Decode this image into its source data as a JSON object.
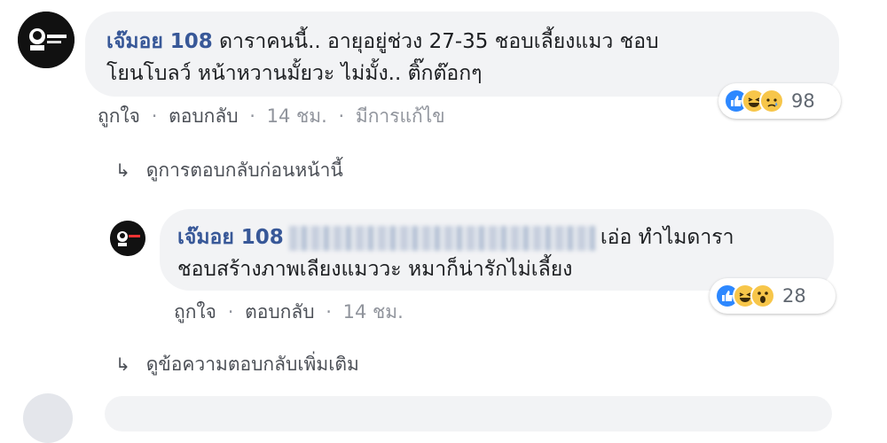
{
  "comment": {
    "author": "เจ๊มอย 108",
    "text_line1": " ดาราคนนี้.. อายุอยู่ช่วง 27-35 ชอบเลี้ยงแมว ชอบ",
    "text_line2": "โยนโบลว์ หน้าหวานมั้ยวะ ไม่มั้ง.. ติ๊กต๊อกๆ",
    "actions": {
      "like": "ถูกใจ",
      "reply": "ตอบกลับ",
      "time": "14 ชม.",
      "edited": "มีการแก้ไข",
      "separator": "·"
    },
    "reaction_count": "98",
    "reaction_icons": [
      "like-icon",
      "haha-icon",
      "sad-icon"
    ]
  },
  "view_previous": "ดูการตอบกลับก่อนหน้านี้",
  "reply": {
    "author": "เจ๊มอย 108",
    "text_line1_end": "เอ่อ ทำไมดารา",
    "text_line2": "ชอบสร้างภาพเลียงแมววะ หมาก็น่ารักไม่เลี้ยง",
    "actions": {
      "like": "ถูกใจ",
      "reply": "ตอบกลับ",
      "time": "14 ชม.",
      "separator": "·"
    },
    "reaction_count": "28",
    "reaction_icons": [
      "like-icon",
      "haha-icon",
      "wow-icon"
    ]
  },
  "view_more": "ดูข้อความตอบกลับเพิ่มเติม",
  "reply_arrow_glyph": "↳",
  "colors": {
    "author": "#385898",
    "bubble": "#f2f3f5",
    "meta": "#90949c",
    "like": "#2d88ff",
    "emoji": "#f7c64a"
  }
}
